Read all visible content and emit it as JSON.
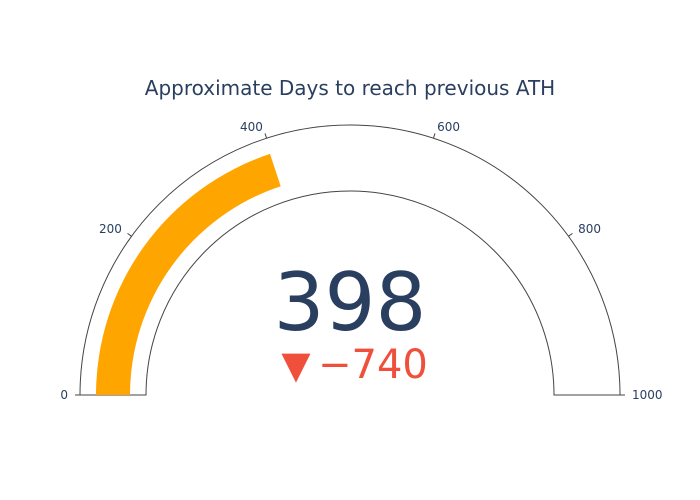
{
  "chart_data": {
    "type": "gauge",
    "title": "Approximate Days to reach previous ATH",
    "value": 398,
    "value_label": "398",
    "delta": {
      "value": -740,
      "symbol": "▼",
      "label": "−740",
      "color": "#ef4f3b"
    },
    "range": [
      0,
      1000
    ],
    "ticks": [
      {
        "value": 0,
        "label": "0"
      },
      {
        "value": 200,
        "label": "200"
      },
      {
        "value": 400,
        "label": "400"
      },
      {
        "value": 600,
        "label": "600"
      },
      {
        "value": 800,
        "label": "800"
      },
      {
        "value": 1000,
        "label": "1000"
      }
    ]
  },
  "colors": {
    "bar": "#ffa500",
    "text": "#2a3f5f",
    "outline": "#444444",
    "background": "#ffffff"
  }
}
